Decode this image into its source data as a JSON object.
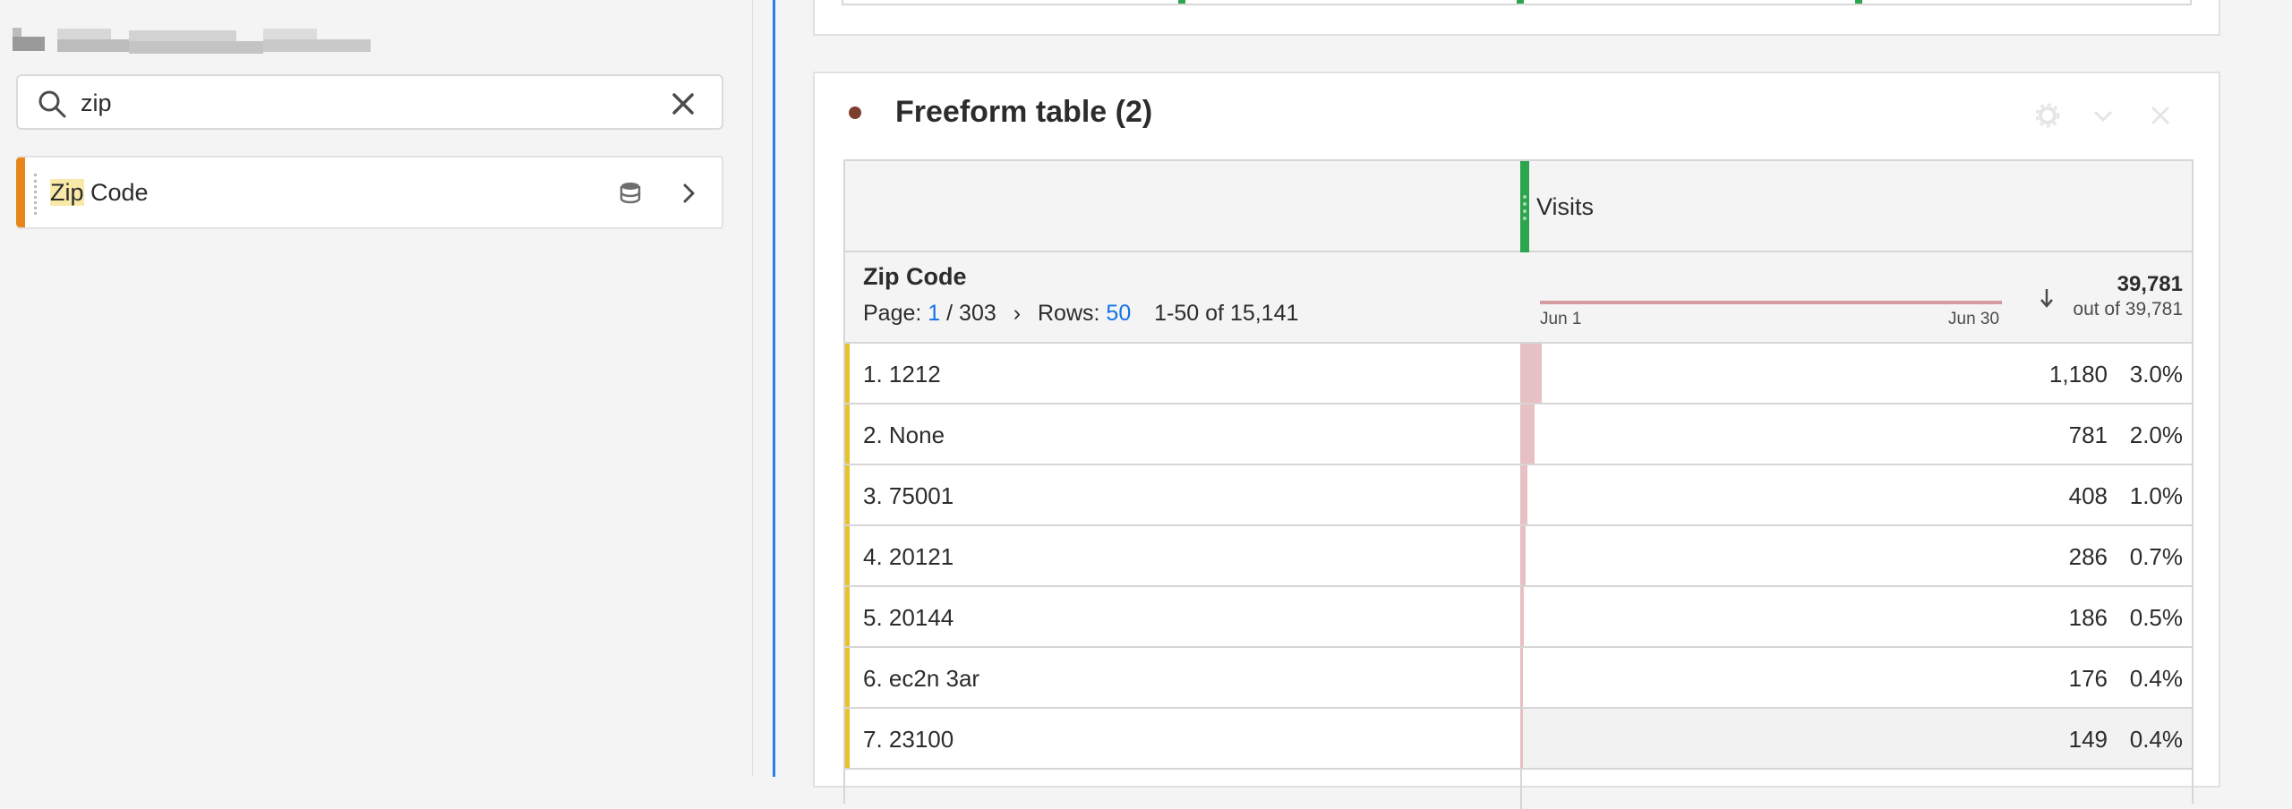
{
  "left_panel": {
    "search": {
      "value": "zip",
      "placeholder": ""
    },
    "results": [
      {
        "highlight": "Zip",
        "rest": " Code"
      }
    ]
  },
  "panel": {
    "title": "Freeform table (2)",
    "metric": "Visits",
    "dimension": "Zip Code",
    "pager": {
      "page_label": "Page:",
      "page": "1",
      "page_total": "/ 303",
      "rows_label": "Rows:",
      "rows": "50",
      "range": "1-50 of 15,141"
    },
    "sparkline": {
      "start": "Jun 1",
      "end": "Jun 30"
    },
    "total": {
      "value": "39,781",
      "sub": "out of 39,781"
    },
    "rows": [
      {
        "label": "1.  1212",
        "value": "1,180",
        "pct": "3.0%",
        "share": 0.03
      },
      {
        "label": "2.  None",
        "value": "781",
        "pct": "2.0%",
        "share": 0.02
      },
      {
        "label": "3.  75001",
        "value": "408",
        "pct": "1.0%",
        "share": 0.01
      },
      {
        "label": "4.  20121",
        "value": "286",
        "pct": "0.7%",
        "share": 0.007
      },
      {
        "label": "5.  20144",
        "value": "186",
        "pct": "0.5%",
        "share": 0.005
      },
      {
        "label": "6.  ec2n 3ar",
        "value": "176",
        "pct": "0.4%",
        "share": 0.004
      },
      {
        "label": "7.  23100",
        "value": "149",
        "pct": "0.4%",
        "share": 0.004
      }
    ]
  },
  "colors": {
    "accent_blue": "#2680eb",
    "metric_green": "#2da44e",
    "row_yellow": "#e6c32a",
    "bar_pink": "#e6c0c2",
    "item_orange": "#e68619"
  }
}
